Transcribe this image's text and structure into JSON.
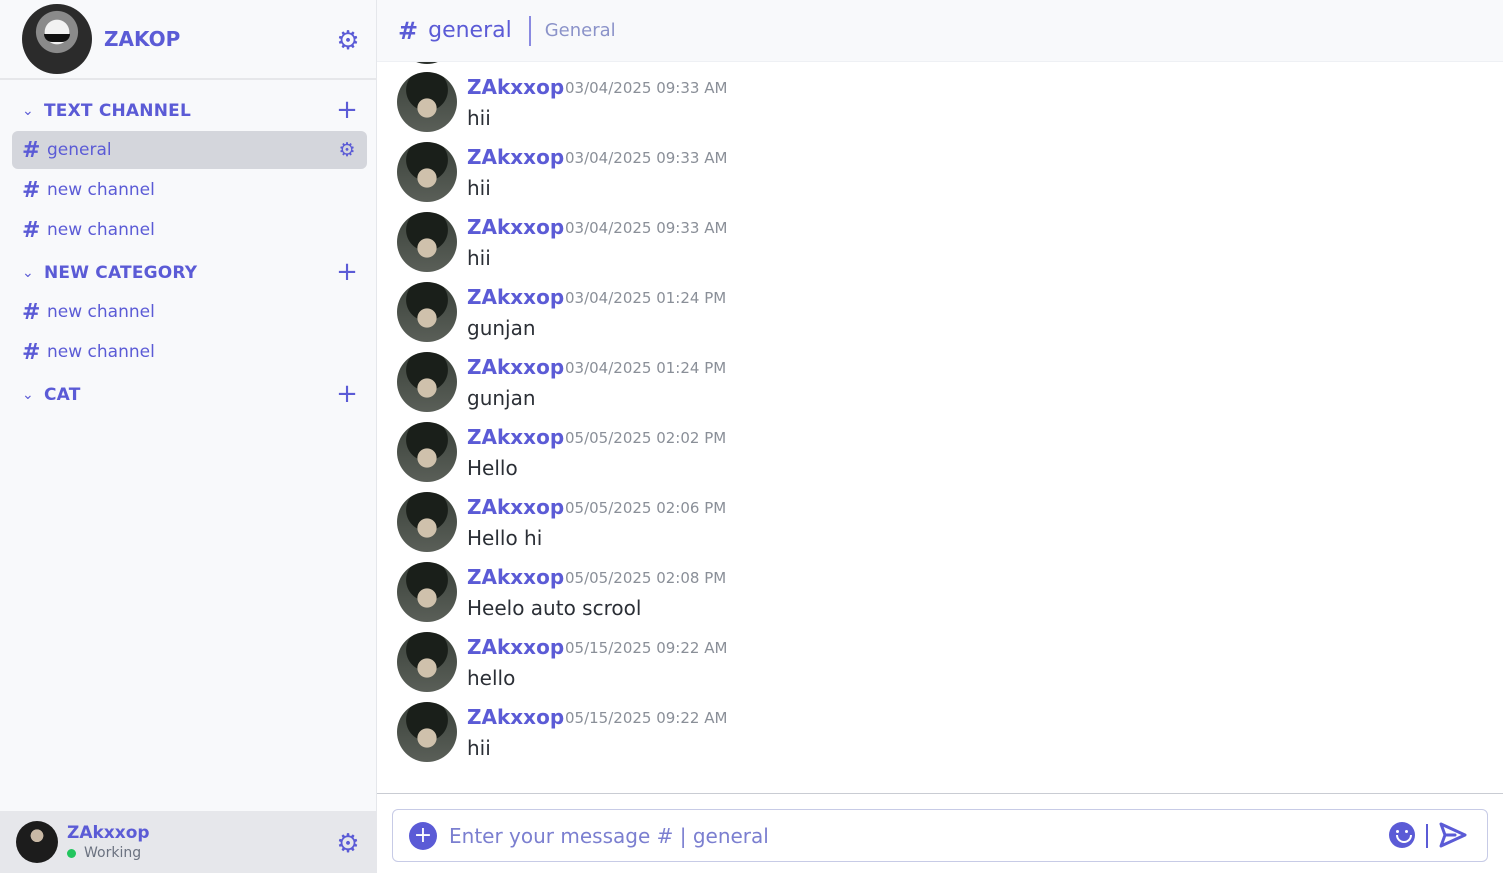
{
  "server": {
    "name": "ZAKOP",
    "settings_icon": "gear-icon"
  },
  "categories": [
    {
      "label": "TEXT CHANNEL",
      "channels": [
        {
          "label": "general",
          "active": true
        },
        {
          "label": "new channel",
          "active": false
        },
        {
          "label": "new channel",
          "active": false
        }
      ]
    },
    {
      "label": "NEW CATEGORY",
      "channels": [
        {
          "label": "new channel",
          "active": false
        },
        {
          "label": "new channel",
          "active": false
        }
      ]
    },
    {
      "label": "CAT",
      "channels": []
    }
  ],
  "channel_prefix": "#",
  "user": {
    "name": "ZAkxxop",
    "status": "Working",
    "status_color": "#22c55e"
  },
  "header": {
    "hash": "#",
    "channel": "general",
    "topic": "General"
  },
  "messages": [
    {
      "author": "ZAkxxop",
      "time": "03/04/2025 09:33 AM",
      "text": "hii"
    },
    {
      "author": "ZAkxxop",
      "time": "03/04/2025 09:33 AM",
      "text": "hii"
    },
    {
      "author": "ZAkxxop",
      "time": "03/04/2025 09:33 AM",
      "text": "hii"
    },
    {
      "author": "ZAkxxop",
      "time": "03/04/2025 01:24 PM",
      "text": "gunjan"
    },
    {
      "author": "ZAkxxop",
      "time": "03/04/2025 01:24 PM",
      "text": "gunjan"
    },
    {
      "author": "ZAkxxop",
      "time": "05/05/2025 02:02 PM",
      "text": "Hello"
    },
    {
      "author": "ZAkxxop",
      "time": "05/05/2025 02:06 PM",
      "text": "Hello hi"
    },
    {
      "author": "ZAkxxop",
      "time": "05/05/2025 02:08 PM",
      "text": "Heelo auto scrool"
    },
    {
      "author": "ZAkxxop",
      "time": "05/15/2025 09:22 AM",
      "text": "hello"
    },
    {
      "author": "ZAkxxop",
      "time": "05/15/2025 09:22 AM",
      "text": "hii"
    }
  ],
  "composer": {
    "placeholder": "Enter your message # | general",
    "value": "",
    "add_icon": "plus-circle-icon",
    "emoji_icon": "smile-icon",
    "send_icon": "send-icon"
  },
  "colors": {
    "accent": "#5b5bd6",
    "active_channel_bg": "#d4d6dc",
    "sidebar_bg": "#f8f9fb"
  }
}
